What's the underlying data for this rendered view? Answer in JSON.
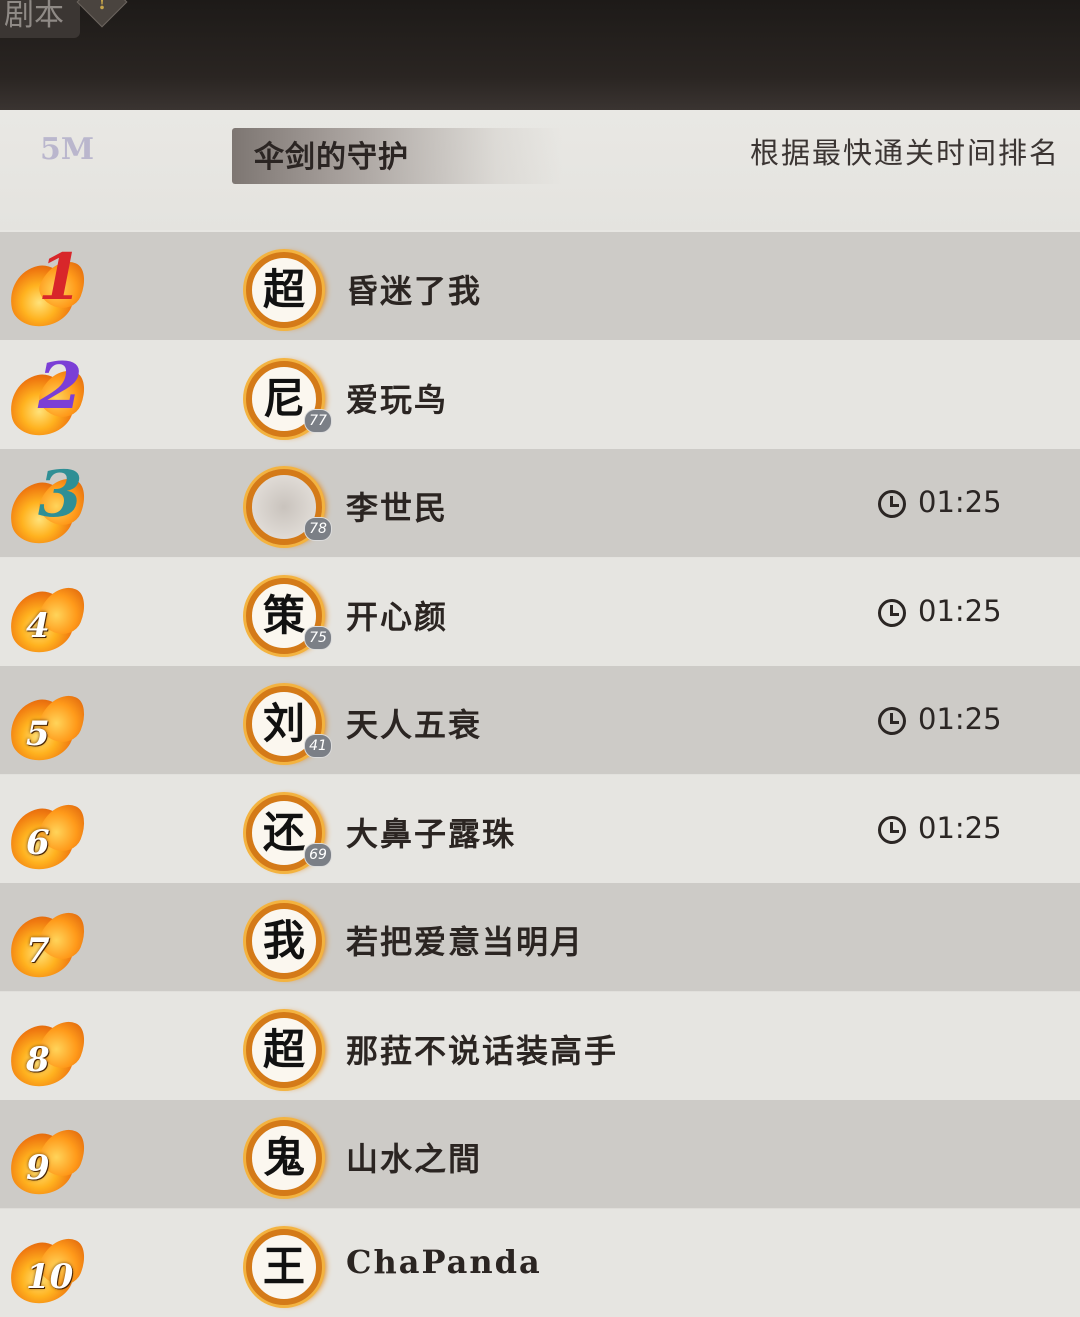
{
  "topbar": {
    "tab_label": "剧本",
    "alert_glyph": "!"
  },
  "header": {
    "emblem": "5M",
    "title": "伞剑的守护",
    "sort_label": "根据最快通关时间排名"
  },
  "rows": [
    {
      "rank": "1",
      "avatar_char": "超",
      "level": "",
      "name": "昏迷了我",
      "time": ""
    },
    {
      "rank": "2",
      "avatar_char": "尼",
      "level": "77",
      "name": "爱玩鸟",
      "time": ""
    },
    {
      "rank": "3",
      "avatar_char": "",
      "level": "78",
      "name": "李世民",
      "time": "01:25"
    },
    {
      "rank": "4",
      "avatar_char": "策",
      "level": "75",
      "name": "开心颜",
      "time": "01:25"
    },
    {
      "rank": "5",
      "avatar_char": "刘",
      "level": "41",
      "name": "天人五衰",
      "time": "01:25"
    },
    {
      "rank": "6",
      "avatar_char": "还",
      "level": "69",
      "name": "大鼻子露珠",
      "time": "01:25"
    },
    {
      "rank": "7",
      "avatar_char": "我",
      "level": "",
      "name": "若把爱意当明月",
      "time": ""
    },
    {
      "rank": "8",
      "avatar_char": "超",
      "level": "",
      "name": "那菈不说话装高手",
      "time": ""
    },
    {
      "rank": "9",
      "avatar_char": "鬼",
      "level": "",
      "name": "山水之間",
      "time": ""
    },
    {
      "rank": "10",
      "avatar_char": "王",
      "level": "",
      "name": "ChaPanda",
      "time": ""
    }
  ],
  "colors": {
    "rank1": "#d8262a",
    "rank2": "#7b3fd6",
    "rank3": "#2f8f95",
    "flame": "#f07a10"
  },
  "icons": {
    "time": "clock-icon",
    "rank_decoration": "flame-icon"
  }
}
